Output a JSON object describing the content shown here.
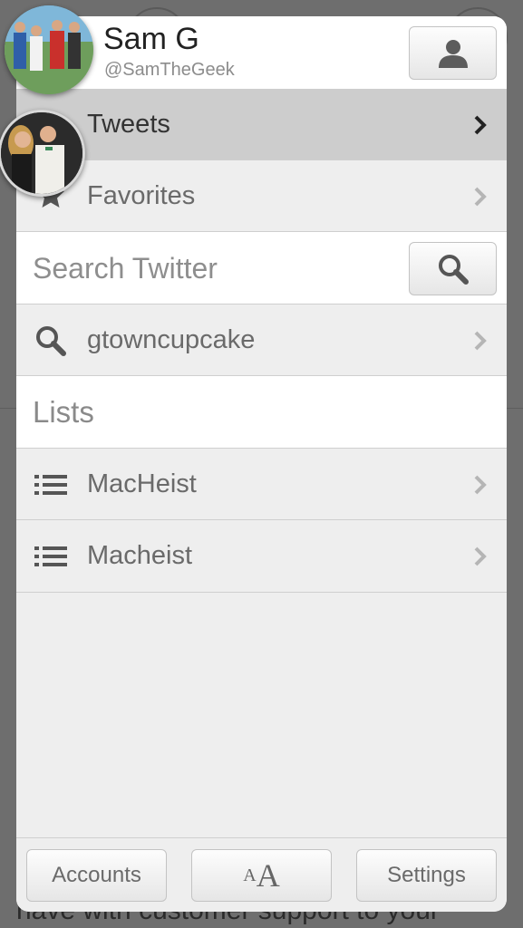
{
  "user": {
    "name": "Sam G",
    "handle": "@SamTheGeek"
  },
  "menu": {
    "tweets_label": "Tweets",
    "favorites_label": "Favorites"
  },
  "search": {
    "placeholder": "Search Twitter",
    "saved_search": "gtowncupcake"
  },
  "lists": {
    "title": "Lists",
    "items": [
      {
        "label": "MacHeist"
      },
      {
        "label": "Macheist"
      }
    ]
  },
  "footer": {
    "accounts_label": "Accounts",
    "font_small": "A",
    "font_big": "A",
    "settings_label": "Settings"
  },
  "background": {
    "text": "have with customer support to your"
  }
}
